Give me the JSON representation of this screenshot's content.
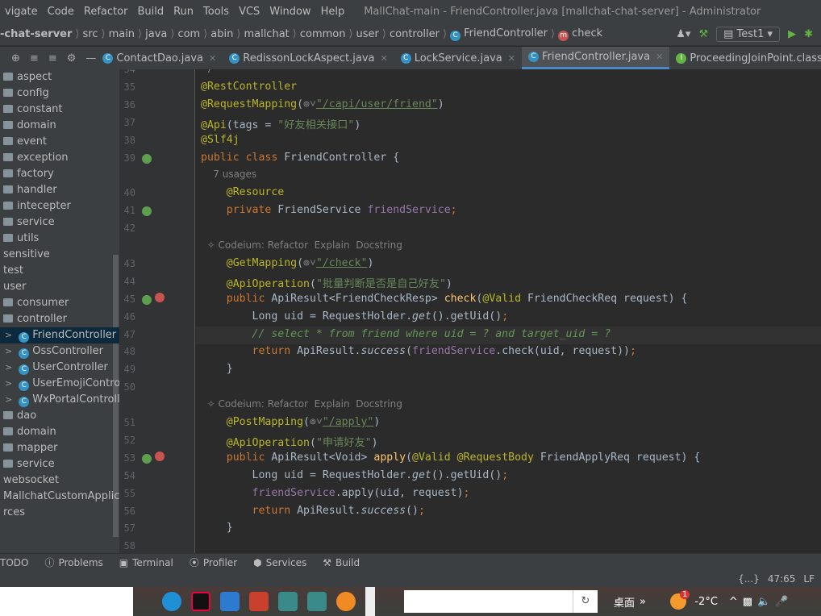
{
  "menu": {
    "items": [
      "vigate",
      "Code",
      "Refactor",
      "Build",
      "Run",
      "Tools",
      "VCS",
      "Window",
      "Help"
    ],
    "title": "MallChat-main - FriendController.java [mallchat-chat-server] - Administrator"
  },
  "nav": {
    "crumbs": [
      "-chat-server",
      "src",
      "main",
      "java",
      "com",
      "abin",
      "mallchat",
      "common",
      "user",
      "controller",
      "FriendController",
      "check"
    ],
    "run_config": "Test1"
  },
  "tabs": [
    {
      "label": "ContactDao.java"
    },
    {
      "label": "RedissonLockAspect.java"
    },
    {
      "label": "LockService.java"
    },
    {
      "label": "FriendController.java",
      "active": true
    },
    {
      "label": "ProceedingJoinPoint.class"
    }
  ],
  "tree": [
    {
      "label": "aspect",
      "type": "folder",
      "indent": 0
    },
    {
      "label": "config",
      "type": "folder",
      "indent": 0
    },
    {
      "label": "constant",
      "type": "folder",
      "indent": 0
    },
    {
      "label": "domain",
      "type": "folder",
      "indent": 0
    },
    {
      "label": "event",
      "type": "folder",
      "indent": 0
    },
    {
      "label": "exception",
      "type": "folder",
      "indent": 0
    },
    {
      "label": "factory",
      "type": "folder",
      "indent": 0
    },
    {
      "label": "handler",
      "type": "folder",
      "indent": 0
    },
    {
      "label": "intecepter",
      "type": "folder",
      "indent": 0
    },
    {
      "label": "service",
      "type": "folder",
      "indent": 0
    },
    {
      "label": "utils",
      "type": "folder",
      "indent": 0
    },
    {
      "label": "sensitive",
      "type": "text",
      "indent": 0
    },
    {
      "label": "test",
      "type": "text",
      "indent": 0
    },
    {
      "label": "user",
      "type": "text",
      "indent": 0
    },
    {
      "label": "consumer",
      "type": "folder",
      "indent": 0
    },
    {
      "label": "controller",
      "type": "folder",
      "indent": 0
    },
    {
      "label": "FriendController",
      "type": "class",
      "indent": 1,
      "selected": true
    },
    {
      "label": "OssController",
      "type": "class",
      "indent": 1
    },
    {
      "label": "UserController",
      "type": "class",
      "indent": 1
    },
    {
      "label": "UserEmojiController",
      "type": "class",
      "indent": 1
    },
    {
      "label": "WxPortalController",
      "type": "class",
      "indent": 1
    },
    {
      "label": "dao",
      "type": "folder",
      "indent": 0
    },
    {
      "label": "domain",
      "type": "folder",
      "indent": 0
    },
    {
      "label": "mapper",
      "type": "folder",
      "indent": 0
    },
    {
      "label": "service",
      "type": "folder",
      "indent": 0
    },
    {
      "label": "websocket",
      "type": "text",
      "indent": 0
    },
    {
      "label": "MallchatCustomApplication",
      "type": "text",
      "indent": 0
    },
    {
      "label": "rces",
      "type": "text",
      "indent": 0
    }
  ],
  "editor": {
    "current_line": "47",
    "lines": [
      {
        "n": "34",
        "tokens": [
          {
            "t": "*/",
            "c": "gr"
          }
        ]
      },
      {
        "n": "35",
        "tokens": [
          {
            "t": "@RestController",
            "c": "an"
          }
        ]
      },
      {
        "n": "36",
        "tokens": [
          {
            "t": "@RequestMapping",
            "c": "an"
          },
          {
            "t": "(",
            "c": "pl"
          },
          {
            "t": "⊚˅",
            "c": "gr"
          },
          {
            "t": "\"/capi/user/friend\"",
            "c": "st ul"
          },
          {
            "t": ")",
            "c": "pl"
          }
        ]
      },
      {
        "n": "37",
        "tokens": [
          {
            "t": "@Api",
            "c": "an"
          },
          {
            "t": "(tags = ",
            "c": "pl"
          },
          {
            "t": "\"好友相关接口\"",
            "c": "st"
          },
          {
            "t": ")",
            "c": "pl"
          }
        ]
      },
      {
        "n": "38",
        "tokens": [
          {
            "t": "@Slf4j",
            "c": "an"
          }
        ]
      },
      {
        "n": "39",
        "tokens": [
          {
            "t": "public class ",
            "c": "kw"
          },
          {
            "t": "FriendController {",
            "c": "pl"
          }
        ]
      },
      {
        "n": "",
        "tokens": [
          {
            "t": "    7 usages",
            "c": "hint"
          }
        ]
      },
      {
        "n": "40",
        "tokens": [
          {
            "t": "    @Resource",
            "c": "an"
          }
        ]
      },
      {
        "n": "41",
        "tokens": [
          {
            "t": "    private ",
            "c": "kw"
          },
          {
            "t": "FriendService ",
            "c": "pl"
          },
          {
            "t": "friendService",
            "c": "fd"
          },
          {
            "t": ";",
            "c": "kw"
          }
        ]
      },
      {
        "n": "42",
        "tokens": []
      },
      {
        "n": "",
        "tokens": [
          {
            "t": "  ✧ Codeium: Refactor  Explain  Docstring",
            "c": "hint"
          }
        ]
      },
      {
        "n": "43",
        "tokens": [
          {
            "t": "    @GetMapping",
            "c": "an"
          },
          {
            "t": "(",
            "c": "pl"
          },
          {
            "t": "⊚˅",
            "c": "gr"
          },
          {
            "t": "\"/check\"",
            "c": "st ul"
          },
          {
            "t": ")",
            "c": "pl"
          }
        ]
      },
      {
        "n": "44",
        "tokens": [
          {
            "t": "    @ApiOperation",
            "c": "an"
          },
          {
            "t": "(",
            "c": "pl"
          },
          {
            "t": "\"批量判断是否是自己好友\"",
            "c": "st"
          },
          {
            "t": ")",
            "c": "pl"
          }
        ]
      },
      {
        "n": "45",
        "tokens": [
          {
            "t": "    public ",
            "c": "kw"
          },
          {
            "t": "ApiResult<FriendCheckResp> ",
            "c": "pl"
          },
          {
            "t": "check",
            "c": "mt"
          },
          {
            "t": "(",
            "c": "pl"
          },
          {
            "t": "@Valid ",
            "c": "an"
          },
          {
            "t": "FriendCheckReq request) {",
            "c": "pl"
          }
        ]
      },
      {
        "n": "46",
        "tokens": [
          {
            "t": "        Long uid = RequestHolder.",
            "c": "pl"
          },
          {
            "t": "get",
            "c": "pl it"
          },
          {
            "t": "().getUid()",
            "c": "pl"
          },
          {
            "t": ";",
            "c": "kw"
          }
        ]
      },
      {
        "n": "47",
        "tokens": [
          {
            "t": "        // select * from friend where uid = ? and target_uid = ?",
            "c": "cm"
          }
        ]
      },
      {
        "n": "48",
        "tokens": [
          {
            "t": "        return ",
            "c": "kw"
          },
          {
            "t": "ApiResult.",
            "c": "pl"
          },
          {
            "t": "success",
            "c": "pl it"
          },
          {
            "t": "(",
            "c": "pl"
          },
          {
            "t": "friendService",
            "c": "fd"
          },
          {
            "t": ".check(uid, request))",
            "c": "pl"
          },
          {
            "t": ";",
            "c": "kw"
          }
        ]
      },
      {
        "n": "49",
        "tokens": [
          {
            "t": "    }",
            "c": "pl"
          }
        ]
      },
      {
        "n": "50",
        "tokens": []
      },
      {
        "n": "",
        "tokens": [
          {
            "t": "  ✧ Codeium: Refactor  Explain  Docstring",
            "c": "hint"
          }
        ]
      },
      {
        "n": "51",
        "tokens": [
          {
            "t": "    @PostMapping",
            "c": "an"
          },
          {
            "t": "(",
            "c": "pl"
          },
          {
            "t": "⊚˅",
            "c": "gr"
          },
          {
            "t": "\"/apply\"",
            "c": "st ul"
          },
          {
            "t": ")",
            "c": "pl"
          }
        ]
      },
      {
        "n": "52",
        "tokens": [
          {
            "t": "    @ApiOperation",
            "c": "an"
          },
          {
            "t": "(",
            "c": "pl"
          },
          {
            "t": "\"申请好友\"",
            "c": "st"
          },
          {
            "t": ")",
            "c": "pl"
          }
        ]
      },
      {
        "n": "53",
        "tokens": [
          {
            "t": "    public ",
            "c": "kw"
          },
          {
            "t": "ApiResult<Void> ",
            "c": "pl"
          },
          {
            "t": "apply",
            "c": "mt"
          },
          {
            "t": "(",
            "c": "pl"
          },
          {
            "t": "@Valid @RequestBody ",
            "c": "an"
          },
          {
            "t": "FriendApplyReq request) {",
            "c": "pl"
          }
        ]
      },
      {
        "n": "54",
        "tokens": [
          {
            "t": "        Long uid = RequestHolder.",
            "c": "pl"
          },
          {
            "t": "get",
            "c": "pl it"
          },
          {
            "t": "().getUid()",
            "c": "pl"
          },
          {
            "t": ";",
            "c": "kw"
          }
        ]
      },
      {
        "n": "55",
        "tokens": [
          {
            "t": "        friendService",
            "c": "fd"
          },
          {
            "t": ".apply(uid, request)",
            "c": "pl"
          },
          {
            "t": ";",
            "c": "kw"
          }
        ]
      },
      {
        "n": "56",
        "tokens": [
          {
            "t": "        return ",
            "c": "kw"
          },
          {
            "t": "ApiResult.",
            "c": "pl"
          },
          {
            "t": "success",
            "c": "pl it"
          },
          {
            "t": "()",
            "c": "pl"
          },
          {
            "t": ";",
            "c": "kw"
          }
        ]
      },
      {
        "n": "57",
        "tokens": [
          {
            "t": "    }",
            "c": "pl"
          }
        ]
      },
      {
        "n": "58",
        "tokens": []
      },
      {
        "n": "",
        "tokens": [
          {
            "t": "  ✧ Codeium: Refactor  Explain  Docstring",
            "c": "hint"
          }
        ]
      }
    ]
  },
  "toolwindows": [
    "TODO",
    "Problems",
    "Terminal",
    "Profiler",
    "Services",
    "Build"
  ],
  "status": {
    "braces": "{...}",
    "position": "47:65",
    "line_sep": "LF"
  },
  "taskbar": {
    "desktop_label": "桌面",
    "temperature": "-2°C",
    "weather_badge": "1"
  }
}
